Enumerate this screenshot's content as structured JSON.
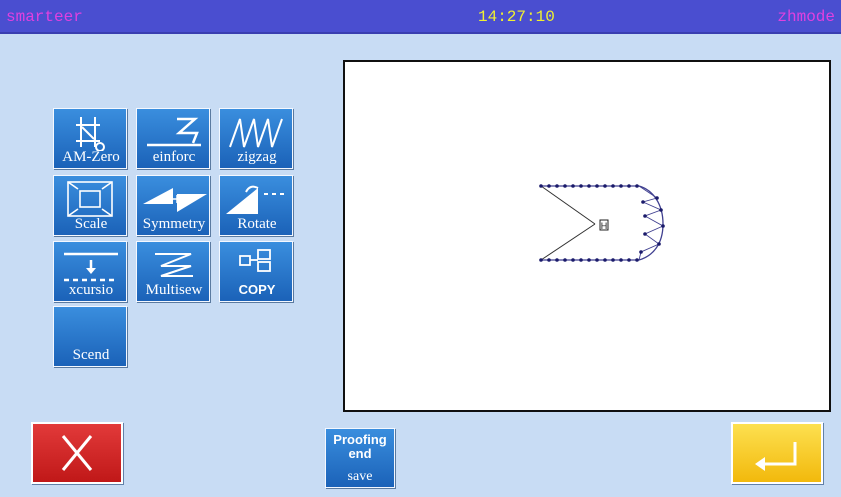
{
  "header": {
    "brand": "smarteer",
    "time": "14:27:10",
    "mode": "zhmode"
  },
  "tools": [
    {
      "label": "AM-Zero",
      "icon": "origin-crosshair-icon"
    },
    {
      "label": "einforc",
      "icon": "reinforce-icon"
    },
    {
      "label": "zigzag",
      "icon": "zigzag-icon"
    },
    {
      "label": "Scale",
      "icon": "scale-icon"
    },
    {
      "label": "Symmetry",
      "icon": "symmetry-icon"
    },
    {
      "label": "Rotate",
      "icon": "rotate-icon"
    },
    {
      "label": "xcursio",
      "icon": "excursion-icon"
    },
    {
      "label": "Multisew",
      "icon": "multisew-icon"
    },
    {
      "label": "COPY",
      "icon": "copy-icon"
    },
    {
      "label": "Scend",
      "icon": ""
    }
  ],
  "canvas": {
    "marker": "H"
  },
  "actions": {
    "cancel": {
      "icon": "close-x-icon"
    },
    "proofing": {
      "line1": "Proofing",
      "line2": "end",
      "line3": "save"
    },
    "enter": {
      "icon": "enter-return-icon"
    }
  },
  "colors": {
    "header": "#4a4ed0",
    "button": "#1b62b8",
    "cancel": "#d42020",
    "enter": "#f7c81c",
    "background": "#c8dcf4"
  }
}
